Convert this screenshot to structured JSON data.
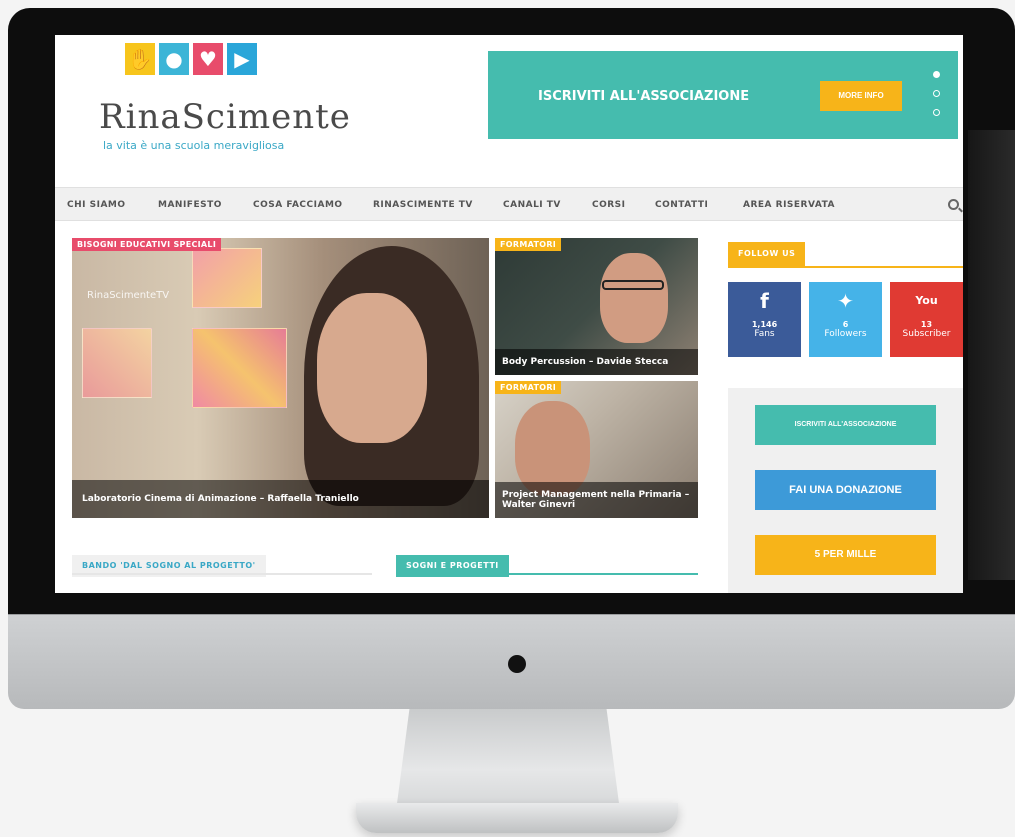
{
  "site": {
    "logo_text": "RinaScimente",
    "tagline": "la vita è una scuola meravigliosa"
  },
  "banner": {
    "title": "ISCRIVITI ALL'ASSOCIAZIONE",
    "button": "MORE INFO"
  },
  "nav": {
    "items": [
      "CHI SIAMO",
      "MANIFESTO",
      "COSA FACCIAMO",
      "RINASCIMENTE TV",
      "CANALI TV",
      "CORSI",
      "CONTATTI",
      "AREA RISERVATA"
    ]
  },
  "featured": {
    "main": {
      "tag": "BISOGNI EDUCATIVI SPECIALI",
      "title": "Laboratorio Cinema di Animazione – Raffaella Traniello",
      "watermark": "RinaScimenteTV"
    },
    "top_right": {
      "tag": "FORMATORI",
      "title": "Body Percussion – Davide Stecca"
    },
    "bottom_right": {
      "tag": "FORMATORI",
      "title": "Project Management nella Primaria – Walter Ginevri"
    }
  },
  "sections": {
    "left": "BANDO 'DAL SOGNO AL PROGETTO'",
    "right": "SOGNI E PROGETTI"
  },
  "sidebar": {
    "follow_label": "FOLLOW US",
    "social": [
      {
        "icon": "facebook-icon",
        "glyph": "f",
        "count": "1,146",
        "unit": "Fans",
        "color": "#3b5b99"
      },
      {
        "icon": "twitter-icon",
        "glyph": "✦",
        "count": "6",
        "unit": "Followers",
        "color": "#45b3e8"
      },
      {
        "icon": "youtube-icon",
        "glyph": "You",
        "count": "13",
        "unit": "Subscriber",
        "color": "#e03a33"
      }
    ],
    "buttons": [
      {
        "label": "ISCRIVITI ALL'ASSOCIAZIONE",
        "color": "#45bcae"
      },
      {
        "label": "FAI UNA DONAZIONE",
        "color": "#3d9ad8"
      },
      {
        "label": "5 PER MILLE",
        "color": "#f7b419"
      }
    ]
  },
  "colors": {
    "teal": "#45bcae",
    "orange": "#f7b419",
    "pink": "#e84c6b",
    "blue_link": "#3aa8c6"
  }
}
